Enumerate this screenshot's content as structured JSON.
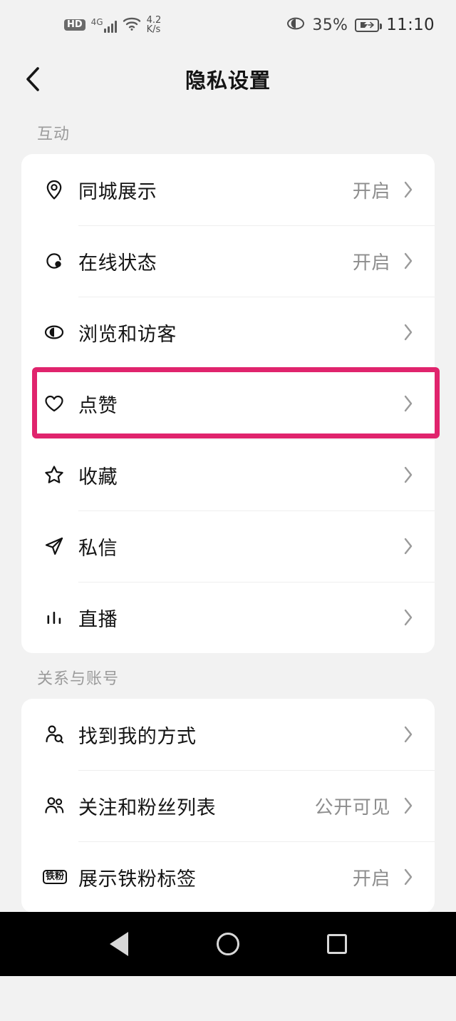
{
  "status_bar": {
    "hd_label": "HD",
    "network_label": "4G",
    "signal_icon": "signal-bars-icon",
    "wifi_icon": "wifi-icon",
    "speed_value": "4.2",
    "speed_unit": "K/s",
    "eye_icon": "eye-care-icon",
    "battery_percent": "35%",
    "battery_icon": "battery-charging-icon",
    "time": "11:10"
  },
  "header": {
    "back_icon": "chevron-left-icon",
    "title": "隐私设置"
  },
  "sections": [
    {
      "label": "互动",
      "rows": [
        {
          "icon": "location-pin-icon",
          "label": "同城展示",
          "value": "开启"
        },
        {
          "icon": "online-status-icon",
          "label": "在线状态",
          "value": "开启"
        },
        {
          "icon": "eye-icon",
          "label": "浏览和访客",
          "value": ""
        },
        {
          "icon": "heart-icon",
          "label": "点赞",
          "value": "",
          "highlighted": true
        },
        {
          "icon": "star-icon",
          "label": "收藏",
          "value": ""
        },
        {
          "icon": "paper-plane-icon",
          "label": "私信",
          "value": ""
        },
        {
          "icon": "live-bars-icon",
          "label": "直播",
          "value": ""
        }
      ]
    },
    {
      "label": "关系与账号",
      "rows": [
        {
          "icon": "person-search-icon",
          "label": "找到我的方式",
          "value": ""
        },
        {
          "icon": "people-icon",
          "label": "关注和粉丝列表",
          "value": "公开可见"
        },
        {
          "icon": "fan-badge-icon",
          "label": "展示铁粉标签",
          "value": "开启",
          "badge_text": "铁粉"
        }
      ]
    }
  ],
  "chevron_glyph": "›",
  "highlight_color": "#e0246d",
  "nav_bar": {
    "back_icon": "nav-back-triangle-icon",
    "home_icon": "nav-home-circle-icon",
    "recents_icon": "nav-recents-square-icon"
  }
}
